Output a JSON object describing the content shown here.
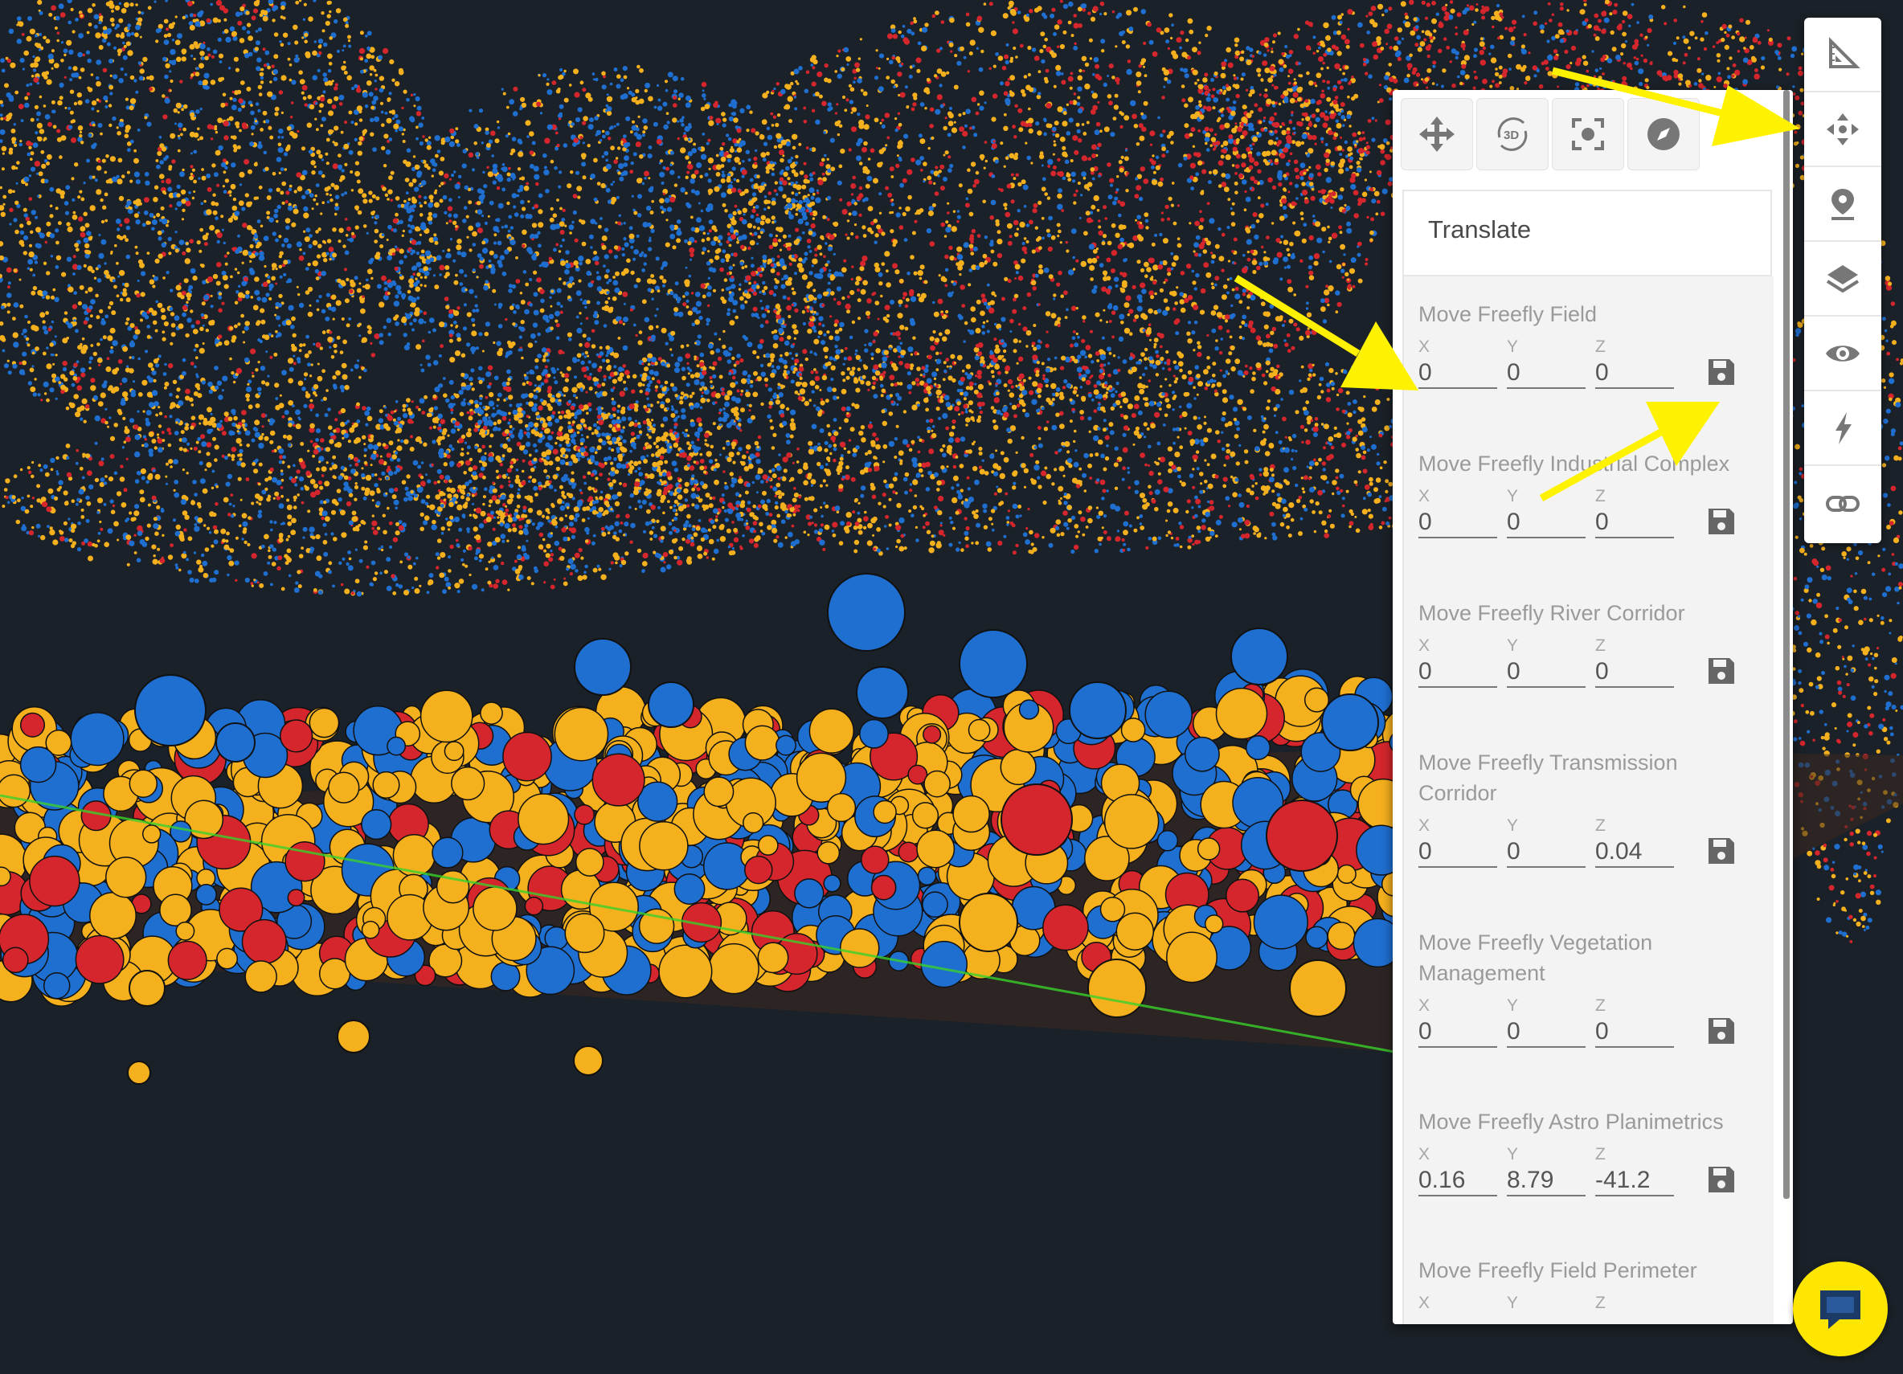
{
  "viewer": {
    "background": "#1b2128",
    "point_colors": [
      "#f5b01e",
      "#1f6fd1",
      "#d4262c"
    ],
    "ground_line_color": "#3ad12b"
  },
  "mode_buttons": [
    {
      "name": "move-arrows-icon"
    },
    {
      "name": "rotate-3d-icon",
      "label": "3D"
    },
    {
      "name": "focus-frame-icon"
    },
    {
      "name": "compass-icon"
    }
  ],
  "panel": {
    "title": "Translate",
    "sections": [
      {
        "title": "Move Freefly Field",
        "x": "0",
        "y": "0",
        "z": "0"
      },
      {
        "title": "Move Freefly Industrial Complex",
        "x": "0",
        "y": "0",
        "z": "0"
      },
      {
        "title": "Move Freefly River Corridor",
        "x": "0",
        "y": "0",
        "z": "0"
      },
      {
        "title": "Move Freefly Transmission Corridor",
        "x": "0",
        "y": "0",
        "z": "0.04"
      },
      {
        "title": "Move Freefly Vegetation Management",
        "x": "0",
        "y": "0",
        "z": "0"
      },
      {
        "title": "Move Freefly Astro Planimetrics",
        "x": "0.16",
        "y": "8.79",
        "z": "-41.2"
      },
      {
        "title": "Move Freefly Field Perimeter",
        "x": "",
        "y": "",
        "z": ""
      }
    ],
    "axis_labels": {
      "x": "X",
      "y": "Y",
      "z": "Z"
    },
    "save_icon": "floppy-disk-icon"
  },
  "toolbar": {
    "tools": [
      {
        "name": "measure-ruler-icon"
      },
      {
        "name": "move-arrows-icon"
      },
      {
        "name": "map-pin-icon"
      },
      {
        "name": "layers-icon"
      },
      {
        "name": "eye-icon"
      },
      {
        "name": "lightning-icon"
      },
      {
        "name": "link-icon"
      }
    ]
  },
  "chat": {
    "icon": "chat-bubble-icon",
    "color": "#ffe600"
  },
  "annotation": {
    "arrow_color": "#fff200"
  }
}
